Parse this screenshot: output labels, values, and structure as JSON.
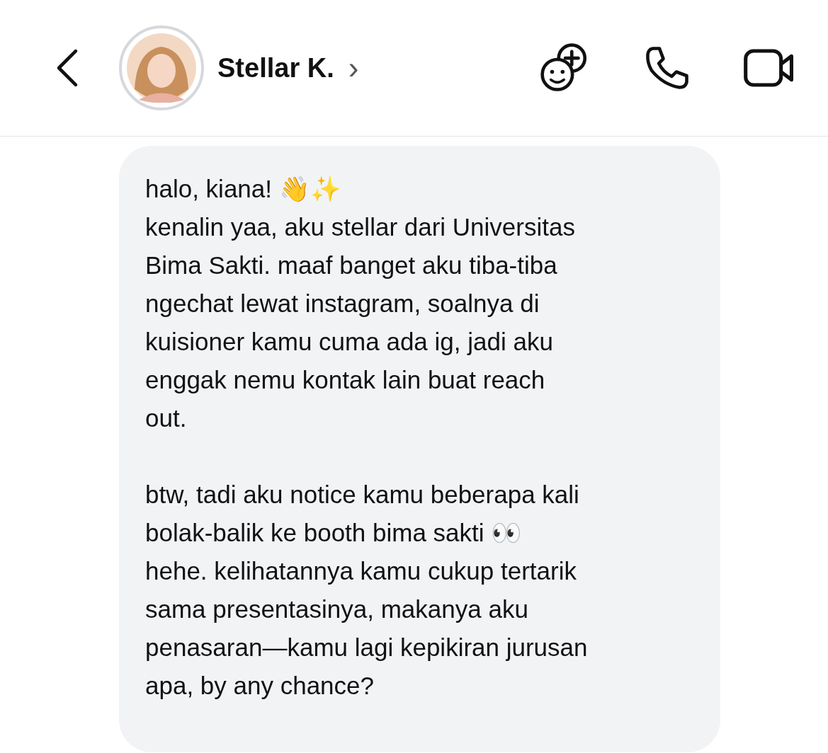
{
  "header": {
    "contact_name": "Stellar K.",
    "chevron": "›"
  },
  "message": {
    "paragraphs": [
      {
        "lines": [
          "halo, kiana! 👋✨",
          "kenalin yaa, aku stellar dari Universitas",
          "Bima Sakti. maaf banget aku tiba-tiba",
          "ngechat lewat instagram, soalnya di",
          "kuisioner kamu cuma ada ig, jadi aku",
          "enggak nemu kontak lain buat reach",
          "out."
        ]
      },
      {
        "lines": [
          "btw, tadi aku notice kamu beberapa kali",
          "bolak-balik ke booth bima sakti 👀",
          "hehe. kelihatannya kamu cukup tertarik",
          "sama presentasinya, makanya aku",
          "penasaran—kamu lagi kepikiran jurusan",
          "apa, by any chance?"
        ]
      }
    ]
  }
}
